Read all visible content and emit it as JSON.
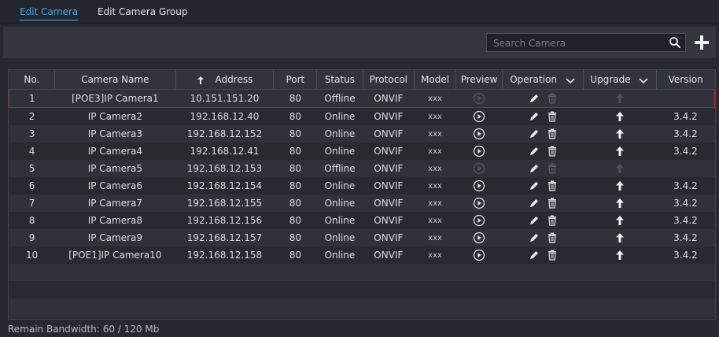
{
  "tabs": [
    {
      "label": "Edit Camera",
      "active": true
    },
    {
      "label": "Edit Camera Group",
      "active": false
    }
  ],
  "search": {
    "placeholder": "Search Camera",
    "value": ""
  },
  "colors": {
    "accent": "#4aa3e8",
    "selected_outline": "#b0222a"
  },
  "table": {
    "columns": {
      "no": "No.",
      "name": "Camera Name",
      "address": "Address",
      "port": "Port",
      "status": "Status",
      "protocol": "Protocol",
      "model": "Model",
      "preview": "Preview",
      "operation": "Operation",
      "upgrade": "Upgrade",
      "version": "Version"
    },
    "sort_column": "Address",
    "rows": [
      {
        "no": "1",
        "name": "[POE3]IP Camera1",
        "address": "10.151.151.20",
        "port": "80",
        "status": "Offline",
        "protocol": "ONVIF",
        "model": "xxx",
        "preview_enabled": false,
        "upgrade_enabled": false,
        "version": ""
      },
      {
        "no": "2",
        "name": "IP Camera2",
        "address": "192.168.12.40",
        "port": "80",
        "status": "Online",
        "protocol": "ONVIF",
        "model": "xxx",
        "preview_enabled": true,
        "upgrade_enabled": true,
        "version": "3.4.2"
      },
      {
        "no": "3",
        "name": "IP Camera3",
        "address": "192.168.12.152",
        "port": "80",
        "status": "Online",
        "protocol": "ONVIF",
        "model": "xxx",
        "preview_enabled": true,
        "upgrade_enabled": true,
        "version": "3.4.2"
      },
      {
        "no": "4",
        "name": "IP Camera4",
        "address": "192.168.12.41",
        "port": "80",
        "status": "Online",
        "protocol": "ONVIF",
        "model": "xxx",
        "preview_enabled": true,
        "upgrade_enabled": true,
        "version": "3.4.2"
      },
      {
        "no": "5",
        "name": "IP Camera5",
        "address": "192.168.12.153",
        "port": "80",
        "status": "Offline",
        "protocol": "ONVIF",
        "model": "xxx",
        "preview_enabled": false,
        "upgrade_enabled": false,
        "version": ""
      },
      {
        "no": "6",
        "name": "IP Camera6",
        "address": "192.168.12.154",
        "port": "80",
        "status": "Online",
        "protocol": "ONVIF",
        "model": "xxx",
        "preview_enabled": true,
        "upgrade_enabled": true,
        "version": "3.4.2"
      },
      {
        "no": "7",
        "name": "IP Camera7",
        "address": "192.168.12.155",
        "port": "80",
        "status": "Online",
        "protocol": "ONVIF",
        "model": "xxx",
        "preview_enabled": true,
        "upgrade_enabled": true,
        "version": "3.4.2"
      },
      {
        "no": "8",
        "name": "IP Camera8",
        "address": "192.168.12.156",
        "port": "80",
        "status": "Online",
        "protocol": "ONVIF",
        "model": "xxx",
        "preview_enabled": true,
        "upgrade_enabled": true,
        "version": "3.4.2"
      },
      {
        "no": "9",
        "name": "IP Camera9",
        "address": "192.168.12.157",
        "port": "80",
        "status": "Online",
        "protocol": "ONVIF",
        "model": "xxx",
        "preview_enabled": true,
        "upgrade_enabled": true,
        "version": "3.4.2"
      },
      {
        "no": "10",
        "name": "[POE1]IP Camera10",
        "address": "192.168.12.158",
        "port": "80",
        "status": "Online",
        "protocol": "ONVIF",
        "model": "xxx",
        "preview_enabled": true,
        "upgrade_enabled": true,
        "version": "3.4.2"
      }
    ]
  },
  "footer": {
    "bandwidth": "Remain Bandwidth: 60 / 120 Mb"
  },
  "icons": {
    "search": "search-icon",
    "add": "plus-icon",
    "sort": "sort-up-arrow-icon",
    "preview": "play-icon",
    "edit": "pencil-icon",
    "delete": "trash-icon",
    "upgrade": "upload-arrow-icon",
    "dropdown": "chevron-down-icon"
  }
}
